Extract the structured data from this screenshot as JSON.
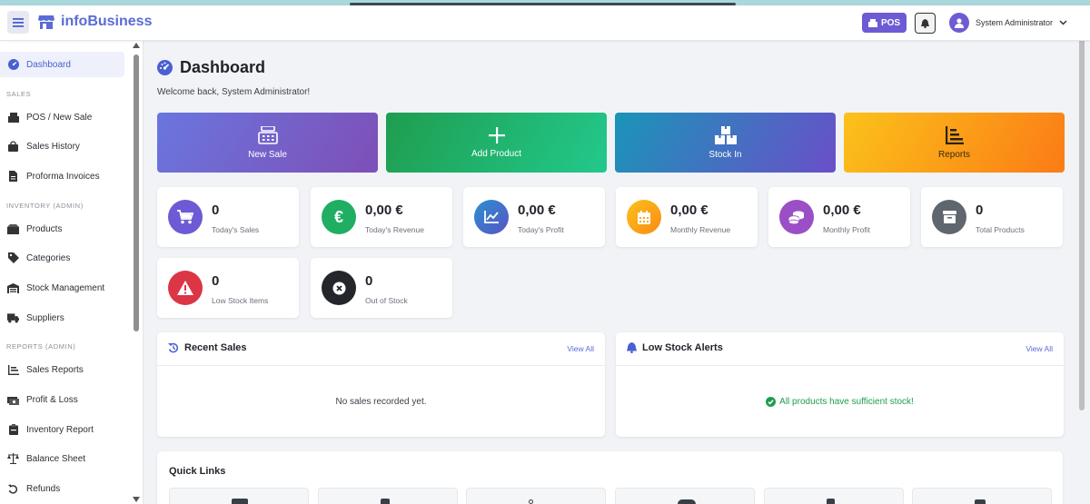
{
  "app": {
    "name": "infoBusiness"
  },
  "header": {
    "pos_label": "POS",
    "user_name": "System Administrator"
  },
  "sidebar": {
    "dashboard": "Dashboard",
    "sec_sales": "SALES",
    "pos_new_sale": "POS / New Sale",
    "sales_history": "Sales History",
    "proforma": "Proforma Invoices",
    "sec_inventory": "INVENTORY (ADMIN)",
    "products": "Products",
    "categories": "Categories",
    "stock_management": "Stock Management",
    "suppliers": "Suppliers",
    "sec_reports": "REPORTS (ADMIN)",
    "sales_reports": "Sales Reports",
    "profit_loss": "Profit & Loss",
    "inventory_report": "Inventory Report",
    "balance_sheet": "Balance Sheet",
    "refunds": "Refunds"
  },
  "page": {
    "title": "Dashboard",
    "welcome": "Welcome back, System Administrator!"
  },
  "actions": {
    "new_sale": "New Sale",
    "add_product": "Add Product",
    "stock_in": "Stock In",
    "reports": "Reports"
  },
  "stats": {
    "todays_sales": {
      "value": "0",
      "label": "Today's Sales"
    },
    "todays_revenue": {
      "value": "0,00 €",
      "label": "Today's Revenue"
    },
    "todays_profit": {
      "value": "0,00 €",
      "label": "Today's Profit"
    },
    "monthly_revenue": {
      "value": "0,00 €",
      "label": "Monthly Revenue"
    },
    "monthly_profit": {
      "value": "0,00 €",
      "label": "Monthly Profit"
    },
    "total_products": {
      "value": "0",
      "label": "Total Products"
    },
    "low_stock": {
      "value": "0",
      "label": "Low Stock Items"
    },
    "out_of_stock": {
      "value": "0",
      "label": "Out of Stock"
    }
  },
  "recent_sales": {
    "title": "Recent Sales",
    "view_all": "View All",
    "empty": "No sales recorded yet."
  },
  "low_stock_alerts": {
    "title": "Low Stock Alerts",
    "view_all": "View All",
    "message": "All products have sufficient stock!"
  },
  "quick_links": {
    "title": "Quick Links"
  },
  "colors": {
    "brand": "#5a6bd6",
    "pos": "#6c5bd4",
    "success": "#1f9d4f",
    "danger": "#dc3545",
    "warning": "#fb9c16"
  }
}
